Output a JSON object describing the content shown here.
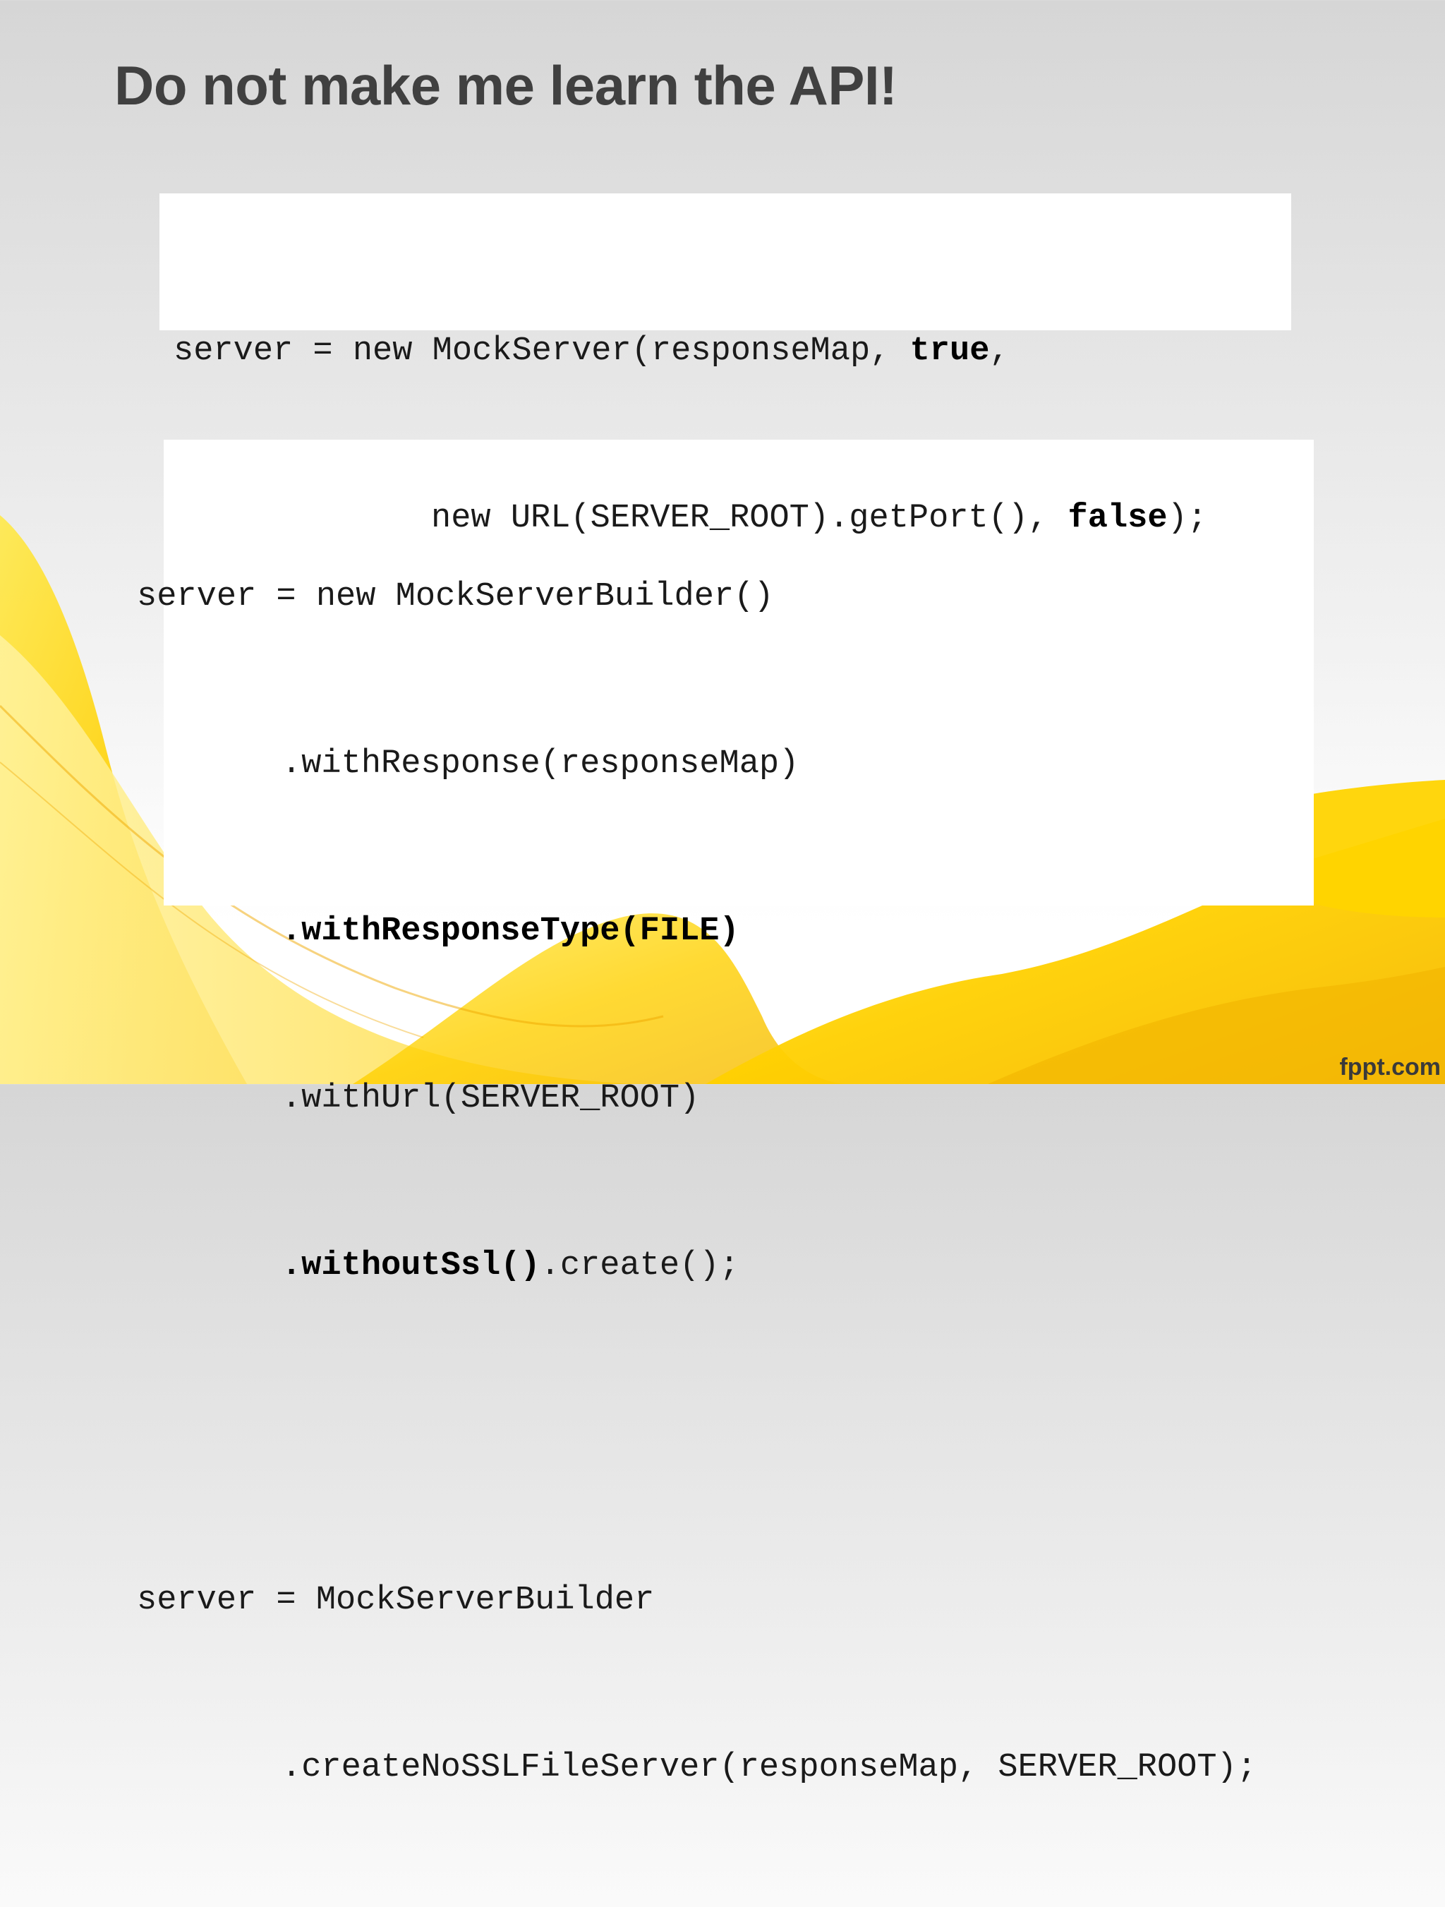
{
  "slide": {
    "title": "Do not make me learn the API!",
    "brand": "fppt.com",
    "accent_color": "#FFD400"
  },
  "code_before": {
    "line1": {
      "a": "server = new MockServer(responseMap, ",
      "b": "true",
      "c": ","
    },
    "line2": {
      "a": "new URL(SERVER_ROOT).getPort(), ",
      "b": "false",
      "c": ");"
    }
  },
  "code_after": {
    "builder": [
      "server = new MockServerBuilder()",
      ".withResponse(responseMap)",
      ".withResponseType(FILE)",
      ".withUrl(SERVER_ROOT)",
      ".withoutSsl()",
      ".create();"
    ],
    "factory": [
      "server = MockServerBuilder",
      ".createNoSSLFileServer(responseMap, SERVER_ROOT);"
    ]
  }
}
